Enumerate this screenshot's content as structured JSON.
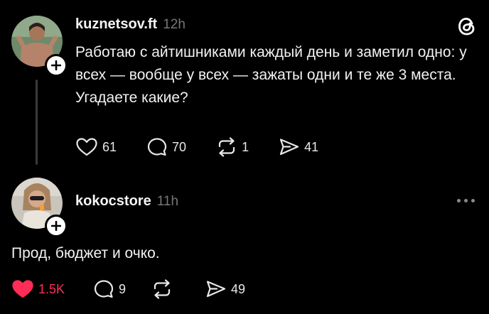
{
  "post1": {
    "username": "kuznetsov.ft",
    "time": "12h",
    "text": "Работаю с айтишниками каждый день и заметил одно: у всех — вообще у всех — зажаты одни и те же 3 места. Угадаете какие?",
    "likes": "61",
    "comments": "70",
    "reposts": "1",
    "shares": "41"
  },
  "post2": {
    "username": "kokocstore",
    "time": "11h",
    "text": "Прод, бюджет и очко.",
    "likes": "1.5K",
    "comments": "9",
    "reposts": "",
    "shares": "49"
  },
  "colors": {
    "background": "#000000",
    "liked": "#ff2d55",
    "muted": "#777777"
  },
  "icons": [
    "threads-logo-icon",
    "heart-icon",
    "comment-icon",
    "repost-icon",
    "share-icon",
    "plus-icon",
    "more-icon"
  ]
}
